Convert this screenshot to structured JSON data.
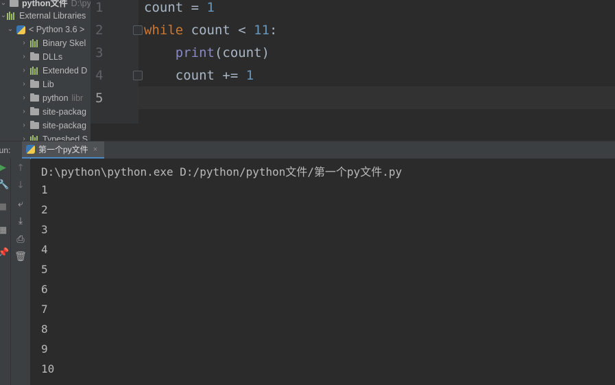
{
  "project": {
    "root_name": "python文件",
    "root_path": "D:\\py",
    "external_libraries": "External Libraries",
    "sdk": "< Python 3.6 >",
    "items": [
      {
        "label": "Binary Skel",
        "icon": "library-icon"
      },
      {
        "label": "DLLs",
        "icon": "folder-icon"
      },
      {
        "label": "Extended D",
        "icon": "library-icon"
      },
      {
        "label": "Lib",
        "icon": "folder-icon"
      },
      {
        "label": "python",
        "suffix": "libr",
        "icon": "folder-icon"
      },
      {
        "label": "site-packag",
        "icon": "folder-icon"
      },
      {
        "label": "site-packag",
        "icon": "folder-icon"
      },
      {
        "label": "Typeshed S",
        "icon": "library-icon"
      }
    ]
  },
  "editor": {
    "line_numbers": [
      "1",
      "2",
      "3",
      "4",
      "5"
    ],
    "lines": {
      "l1_var": "count",
      "l1_op": " = ",
      "l1_num": "1",
      "l2_kw": "while",
      "l2_mid": " count < ",
      "l2_num": "11",
      "l2_end": ":",
      "l3_indent": "    ",
      "l3_fn": "print",
      "l3_rest": "(count)",
      "l4_text": "    count += ",
      "l4_num": "1"
    }
  },
  "run": {
    "label": "Run:",
    "tab_title": "第一个py文件",
    "tab_close": "×",
    "command": "D:\\python\\python.exe D:/python/python文件/第一个py文件.py",
    "output": [
      "1",
      "2",
      "3",
      "4",
      "5",
      "6",
      "7",
      "8",
      "9",
      "10"
    ]
  },
  "colors": {
    "keyword": "#cc7832",
    "number": "#6897bb",
    "builtin": "#8888c6",
    "tab_underline": "#4a88c7",
    "run_icon": "#499c54"
  }
}
